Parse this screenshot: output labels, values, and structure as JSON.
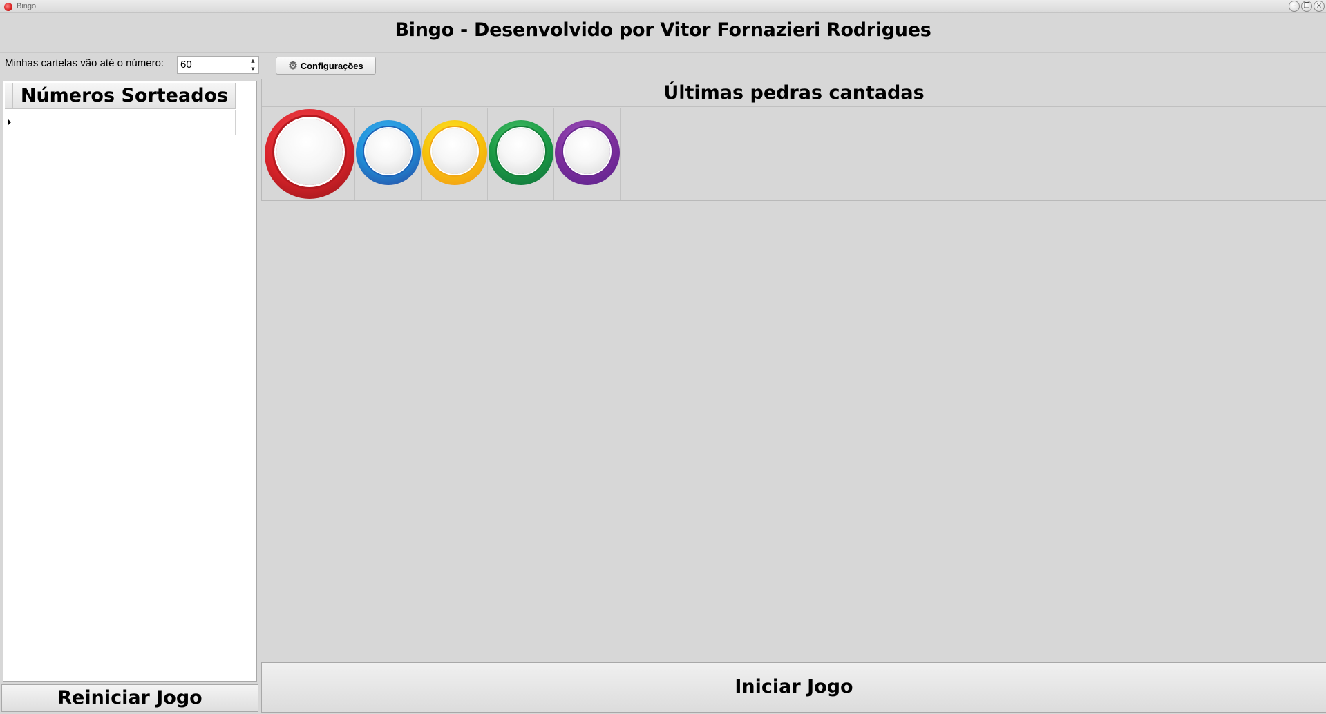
{
  "window": {
    "title": "Bingo"
  },
  "header": {
    "title": "Bingo - Desenvolvido por Vitor Fornazieri Rodrigues"
  },
  "toolbar": {
    "range_label": "Minhas cartelas vão até o número:",
    "range_value": "60",
    "config_label": "Configurações"
  },
  "drawn_numbers": {
    "header": "Números Sorteados",
    "rows": []
  },
  "last_stones": {
    "title": "Últimas pedras cantadas",
    "balls": [
      {
        "color": "#d8232a",
        "value": ""
      },
      {
        "color": "#1f8fd8",
        "value": ""
      },
      {
        "color": "#f6b50b",
        "value": ""
      },
      {
        "color": "#1b9a45",
        "value": ""
      },
      {
        "color": "#7d2e9c",
        "value": ""
      }
    ]
  },
  "buttons": {
    "reset": "Reiniciar Jogo",
    "start": "Iniciar Jogo"
  }
}
